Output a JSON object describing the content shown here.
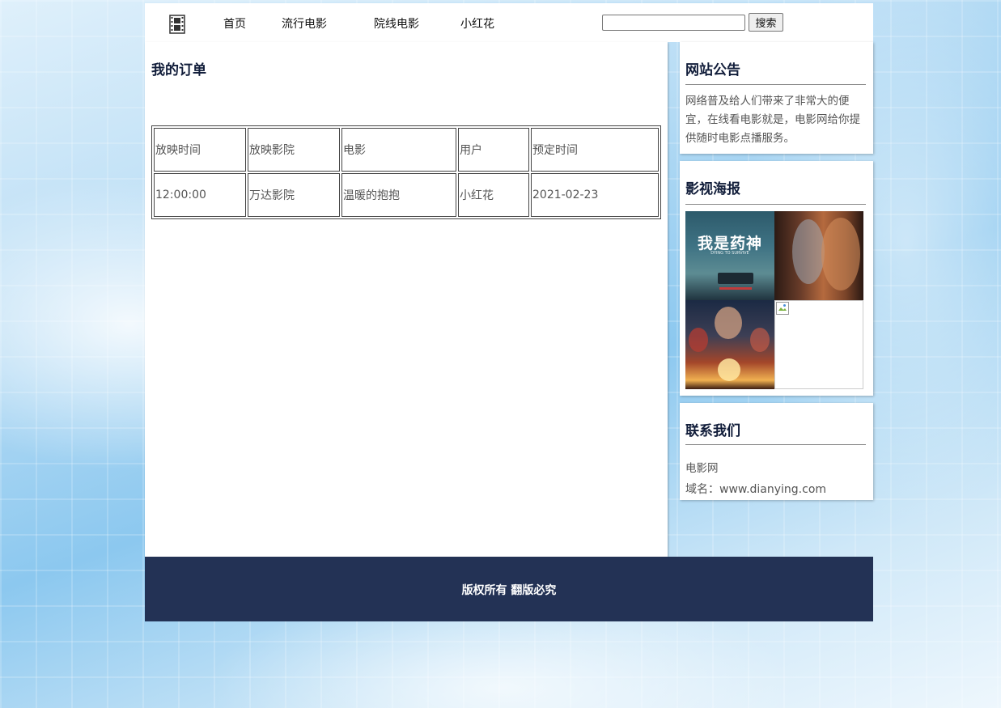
{
  "header": {
    "logo_icon": "film-strip-icon",
    "nav": [
      {
        "label": "首页"
      },
      {
        "label": "流行电影"
      },
      {
        "label": "院线电影"
      },
      {
        "label": "小红花"
      }
    ],
    "search": {
      "value": "",
      "button_label": "搜索"
    }
  },
  "main": {
    "title": "我的订单",
    "table": {
      "headers": [
        "放映时间",
        "放映影院",
        "电影",
        "用户",
        "预定时间"
      ],
      "rows": [
        [
          "12:00:00",
          "万达影院",
          "温暖的抱抱",
          "小红花",
          "2021-02-23"
        ]
      ]
    }
  },
  "sidebar": {
    "announcement": {
      "title": "网站公告",
      "lines": [
        "网络普及给人们带来了非常大的便",
        "宜，在线看电影就是，电影网给你提",
        "供随时电影点播服务。"
      ]
    },
    "posters": {
      "title": "影视海报",
      "items": [
        {
          "caption": "我是药神",
          "sub": "DYING TO SURVIVE"
        },
        {
          "caption": ""
        },
        {
          "caption": ""
        },
        {
          "caption": "",
          "broken": true
        }
      ]
    },
    "contact": {
      "title": "联系我们",
      "site_name": "电影网",
      "domain": "域名：www.dianying.com"
    }
  },
  "footer": {
    "text": "版权所有 翻版必究"
  },
  "colors": {
    "heading": "#111d3a",
    "footer_bg": "#233255",
    "text": "#555555"
  }
}
